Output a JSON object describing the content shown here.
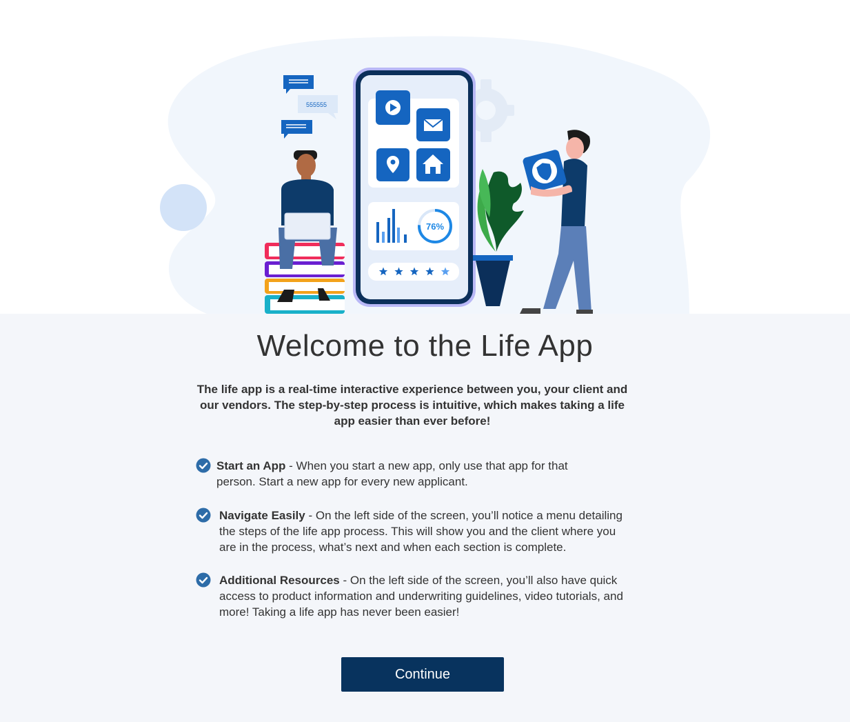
{
  "illustration": {
    "chat_bubble_text": "555555",
    "progress_percent": 76,
    "progress_label": "76%",
    "rating_stars": 5,
    "colors": {
      "blob": "#f1f6fc",
      "app_blue": "#1565c0",
      "navy": "#0b2f5a",
      "light_circle": "#d3e3f8"
    }
  },
  "page": {
    "title": "Welcome to the Life App",
    "intro": "The life app is a real-time interactive experience between you, your client and our vendors. The step-by-step process is intuitive, which makes taking a life app easier than ever before!"
  },
  "features": [
    {
      "icon": "check-circle-icon",
      "term": "Start an App",
      "description": " - When you start a new app, only use that app for that person. Start a new app for every new applicant."
    },
    {
      "icon": "check-circle-icon",
      "term": "Navigate Easily",
      "description": " - On the left side of the screen, you’ll notice a menu detailing the steps of the life app process. This will show you and the client where you are in the process, what’s next and when each section is complete."
    },
    {
      "icon": "check-circle-icon",
      "term": "Additional Resources",
      "description": " - On the left side of the screen, you’ll also have quick access to product information and underwriting guidelines, video tutorials, and more! Taking a life app has never been easier!"
    }
  ],
  "actions": {
    "continue_label": "Continue"
  },
  "theme": {
    "button_bg": "#08335e",
    "check_color": "#2d6ca8",
    "content_bg": "#f4f6fa"
  }
}
